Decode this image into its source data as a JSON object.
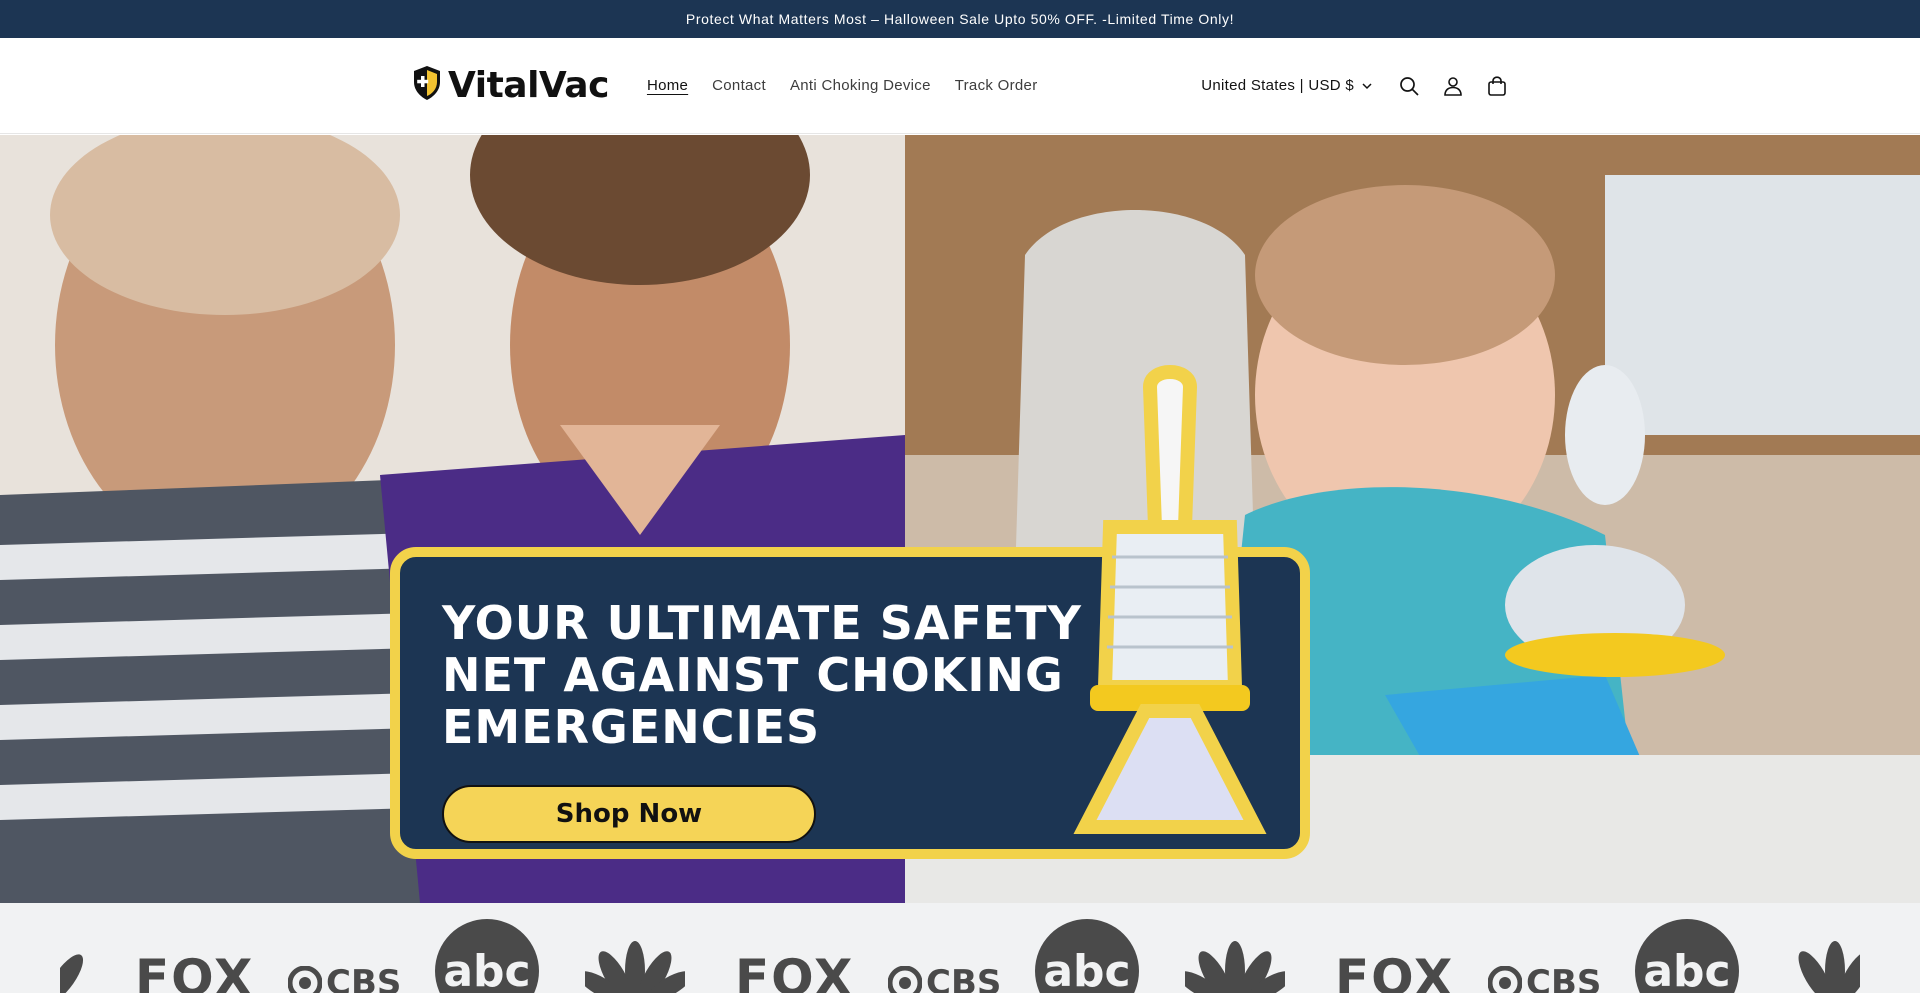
{
  "announcement": {
    "text": "Protect What Matters Most – Halloween Sale Upto 50% OFF. -Limited Time Only!"
  },
  "header": {
    "brand_name": "VitalVac",
    "nav": [
      {
        "label": "Home",
        "active": true
      },
      {
        "label": "Contact",
        "active": false
      },
      {
        "label": "Anti Choking Device",
        "active": false
      },
      {
        "label": "Track Order",
        "active": false
      }
    ],
    "country_selector": "United States | USD $",
    "icons": [
      "search-icon",
      "account-icon",
      "cart-icon",
      "chevron-down-icon"
    ]
  },
  "hero": {
    "headline": "YOUR ULTIMATE SAFETY NET AGAINST CHOKING EMERGENCIES",
    "cta_label": "Shop Now",
    "accent_color": "#f2d24a",
    "panel_color": "#1c3553"
  },
  "press_logos": {
    "items": [
      "nbc",
      "fox",
      "cbs",
      "abc",
      "nbc",
      "fox",
      "cbs",
      "abc",
      "nbc",
      "fox",
      "cbs",
      "abc",
      "nbc"
    ],
    "labels": {
      "fox": "FOX",
      "cbs": "CBS",
      "abc": "abc"
    }
  },
  "colors": {
    "announcement_bg": "#1c3553",
    "cta_bg": "#f5d457"
  }
}
